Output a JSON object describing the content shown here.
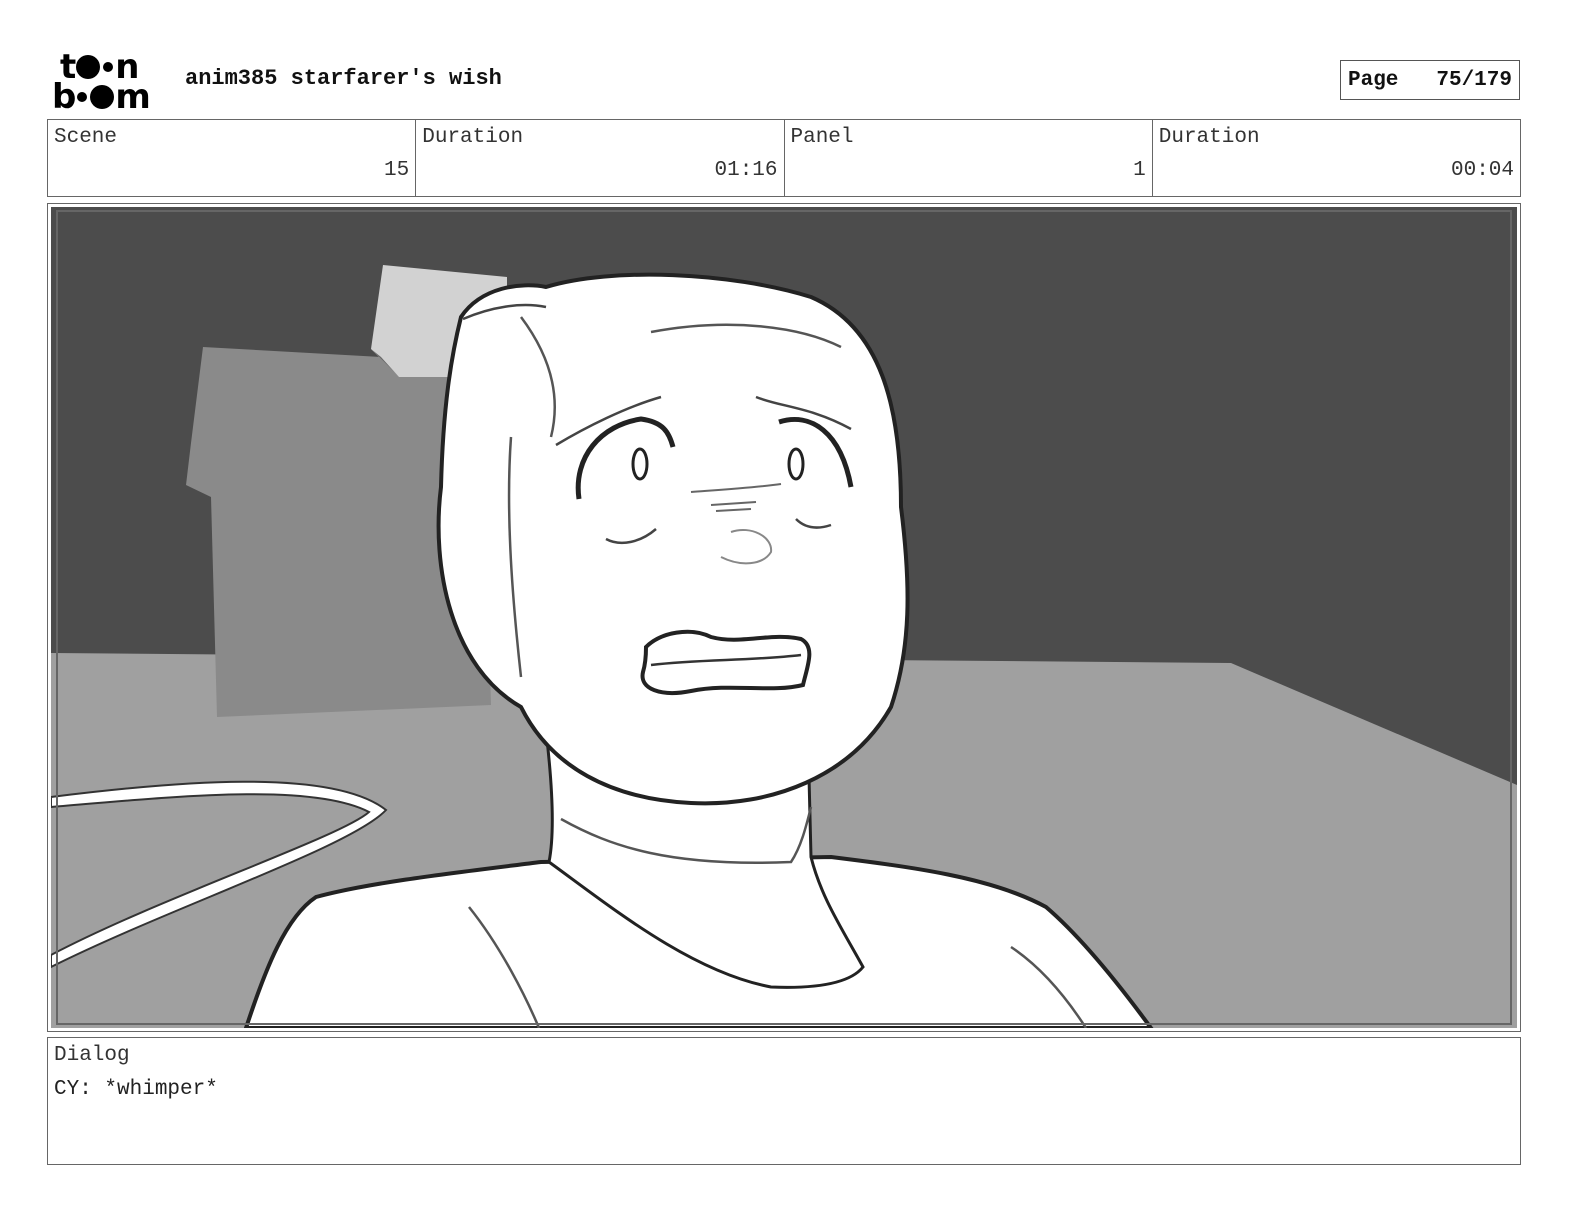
{
  "header": {
    "logo_top": "t",
    "logo_top_end": "n",
    "logo_bottom_start": "b",
    "logo_bottom_end": "m",
    "title": "anim385 starfarer's wish",
    "page_label": "Page",
    "page_value": "75/179"
  },
  "info": [
    {
      "label": "Scene",
      "value": "15"
    },
    {
      "label": "Duration",
      "value": "01:16"
    },
    {
      "label": "Panel",
      "value": "1"
    },
    {
      "label": "Duration",
      "value": "00:04"
    }
  ],
  "dialog": {
    "label": "Dialog",
    "text": "CY: *whimper*"
  },
  "colors": {
    "wall": "#4c4c4c",
    "floor": "#a0a0a0",
    "box": "#8a8a8a",
    "character": "#ffffff",
    "line": "#222222"
  }
}
